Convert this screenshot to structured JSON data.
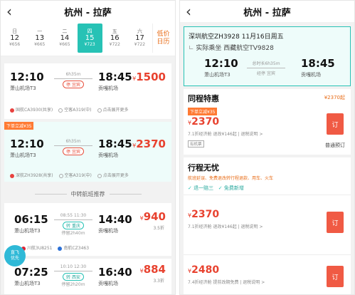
{
  "left": {
    "header": {
      "title": "杭州 - 拉萨",
      "back": "‹"
    },
    "dates": [
      {
        "weekday": "日",
        "day": "12",
        "price": "¥656",
        "selected": false
      },
      {
        "weekday": "一",
        "day": "13",
        "price": "¥665",
        "selected": false
      },
      {
        "weekday": "二",
        "day": "14",
        "price": "¥665",
        "selected": false
      },
      {
        "weekday": "四",
        "day": "15",
        "price": "¥723",
        "selected": true
      },
      {
        "weekday": "五",
        "day": "16",
        "price": "¥722",
        "selected": false
      },
      {
        "weekday": "六",
        "day": "17",
        "price": "¥722",
        "selected": false
      }
    ],
    "low_calendar": [
      "低价",
      "日历"
    ],
    "flights": [
      {
        "badge": "",
        "dep_time": "12:10",
        "dep_airport": "萧山机场T3",
        "duration": "6h35m",
        "stop": "停 宜宾",
        "arr_time": "18:45",
        "arr_airport": "贡嘎机场",
        "currency": "¥",
        "price": "1500",
        "airline": "国航CA3930(共享)",
        "aircraft": "空客A319(中)",
        "note": "点击展开更多"
      },
      {
        "badge": "下单立减¥35",
        "dep_time": "12:10",
        "dep_airport": "萧山机场T3",
        "duration": "6h35m",
        "stop": "停 宜宾",
        "arr_time": "18:45",
        "arr_airport": "贡嘎机场",
        "currency": "¥",
        "price": "2370",
        "airline": "深航ZH3928(共享)",
        "aircraft": "空客A319(中)",
        "note": "点击展开更多"
      }
    ],
    "transfer_label": "中转航班推荐",
    "transfers": [
      {
        "dep_time": "06:15",
        "dep_airport": "萧山机场T3",
        "times": "08:55 11:30",
        "stop": "转 重庆",
        "layover": "停留2h40m",
        "arr_time": "14:40",
        "arr_airport": "贡嘎机场",
        "currency": "¥",
        "price": "940",
        "discount": "3.5折",
        "airline1": "川航3U8251",
        "airline2": "南航CZ3463"
      },
      {
        "dep_time": "07:25",
        "dep_airport": "萧山机场T3",
        "times": "10:10 12:30",
        "stop": "转 西安",
        "layover": "停留2h20m",
        "arr_time": "16:40",
        "arr_airport": "贡嘎机场",
        "currency": "¥",
        "price": "884",
        "discount": "3.3折"
      }
    ],
    "fab": [
      "直飞",
      "优先"
    ]
  },
  "right": {
    "header": {
      "title": "杭州 - 拉萨",
      "back": "‹"
    },
    "summary": {
      "flight": "深圳航空ZH3928 11月16日周五",
      "actual": "实际乘坐 西藏航空TV9828",
      "dep_time": "12:10",
      "dep_airport": "萧山机场T3",
      "duration": "总时长6h35m",
      "stop": "经停 宜宾",
      "arr_time": "18:45",
      "arr_airport": "贡嘎机场"
    },
    "offer1": {
      "title": "同程特惠",
      "title_price": "¥2370起",
      "badge": "下单立减¥35",
      "currency": "¥",
      "price": "2370",
      "detail": "7.1折经济舱  退改¥146起  | 退税说明 >",
      "tag": "有机票",
      "order": "订",
      "extra": "普通预订"
    },
    "offer2": {
      "title": "行程无忧",
      "desc": "航班延误、免费退改转行程退款、用车、火车",
      "feat1": "退一赔三",
      "feat2": "免费新增",
      "entries": [
        {
          "currency": "¥",
          "price": "2370",
          "detail": "7.1折经济舱  退改¥146起 | 退税说明 >",
          "order": "订"
        },
        {
          "currency": "¥",
          "price": "2480",
          "detail": "7.4折经济舱  提前改期免费 | 退税说明 >",
          "order": "订"
        }
      ]
    }
  }
}
